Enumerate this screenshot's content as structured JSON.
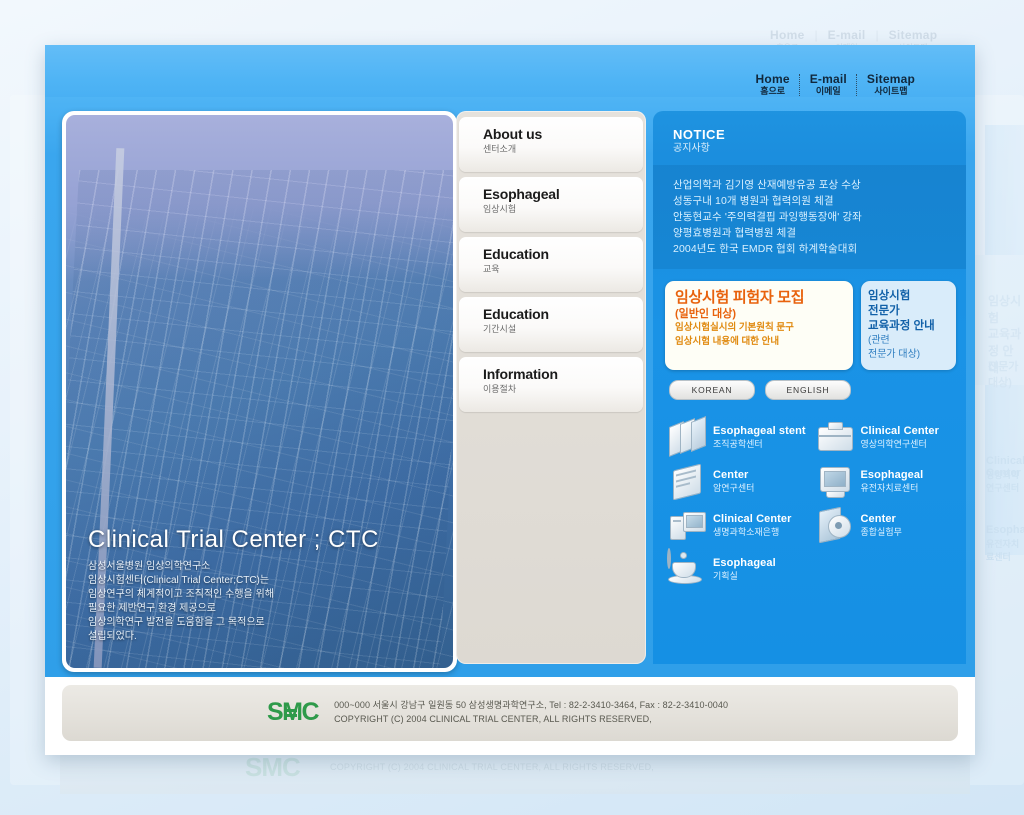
{
  "top_nav": [
    {
      "en": "Home",
      "kr": "홈으로",
      "icon": "home-link"
    },
    {
      "en": "E-mail",
      "kr": "이메일",
      "icon": "email-link"
    },
    {
      "en": "Sitemap",
      "kr": "사이트맵",
      "icon": "sitemap-link"
    }
  ],
  "hero": {
    "title": "Clinical Trial Center ; CTC",
    "lines": [
      "삼성서울병원 임상의학연구소",
      "임상시험센터(Clinical Trial Center;CTC)는",
      "임상연구의 체계적이고  조직적인 수행을 위해",
      "필요한 제반연구 환경 제공으로",
      "임상의학연구 발전을 도움함을  그 목적으로",
      "설립되었다."
    ]
  },
  "menu": [
    {
      "en": "About us",
      "kr": "센터소개"
    },
    {
      "en": "Esophageal",
      "kr": "임상시험"
    },
    {
      "en": "Education",
      "kr": "교육"
    },
    {
      "en": "Education",
      "kr": "기간시설"
    },
    {
      "en": "Information",
      "kr": "이용절차"
    }
  ],
  "notice": {
    "heading_en": "NOTICE",
    "heading_kr": "공지사항",
    "items": [
      "산업의학과 김기영 산재예방유공 포상 수상",
      "성동구내 10개 병원과 협력의원 체결",
      "안동현교수 '주의력결핍 과잉행동장애' 강좌",
      "양평효병원과 협력병원 체결",
      "2004년도 한국 EMDR 협회 하계학술대회"
    ]
  },
  "promo": {
    "white": {
      "title": "임상시험 피험자 모집",
      "subtitle": "(일반인 대상)",
      "lines": [
        "임상시험실시의 기본원칙 문구",
        "임상시험 내용에 대한 안내"
      ]
    },
    "blue": {
      "lines": [
        "임상시험",
        "전문가",
        "교육과정 안내"
      ],
      "sub": [
        "(관련",
        "전문가 대상)"
      ]
    },
    "buttons": [
      {
        "label": "KOREAN"
      },
      {
        "label": "ENGLISH"
      }
    ]
  },
  "icon_grid": [
    {
      "en": "Esophageal stent",
      "kr": "조직공학센터",
      "icon": "books-icon"
    },
    {
      "en": "Clinical Center",
      "kr": "영상의학연구센터",
      "icon": "briefcase-icon"
    },
    {
      "en": "Center",
      "kr": "암연구센터",
      "icon": "documents-icon"
    },
    {
      "en": "Esophageal",
      "kr": "유전자치료센터",
      "icon": "monitor-icon"
    },
    {
      "en": "Clinical Center",
      "kr": "생명과학소재은행",
      "icon": "computer-icon"
    },
    {
      "en": "Center",
      "kr": "종합실험무",
      "icon": "cd-disc-icon"
    },
    {
      "en": "Esophageal",
      "kr": "기획실",
      "icon": "coffee-cup-icon"
    }
  ],
  "footer": {
    "logo": "SMC",
    "address": "000~000 서울시 강남구 일원동 50 삼성생명과학연구소, Tel : 82-2-3410-3464, Fax : 82-2-3410-0040",
    "copyright": "COPYRIGHT (C) 2004 CLINICAL TRIAL CENTER, ALL RIGHTS RESERVED,"
  },
  "colors": {
    "header_blue": "#4fb4f5",
    "panel_blue": "#1a93e6",
    "menu_gray": "#e0dcd5",
    "accent_orange": "#e8620d",
    "logo_green": "#2e9a4a"
  }
}
